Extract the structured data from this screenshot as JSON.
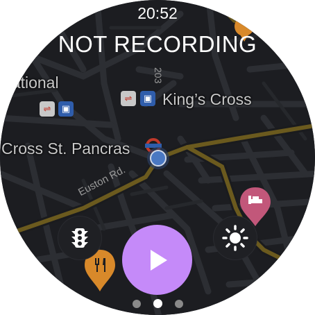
{
  "status_bar": {
    "time": "20:52"
  },
  "recording": {
    "status_text": "NOT RECORDING"
  },
  "map": {
    "labels": {
      "station_left": "national",
      "kings_cross": "King’s Cross",
      "st_pancras": "Cross St. Pancras",
      "euston_road": "Euston Rd.",
      "road_a203": "203"
    },
    "icons": [
      "rail-icon",
      "bus-icon",
      "underground-icon",
      "hotel-pin-icon",
      "restaurant-pin-icon",
      "current-location-icon"
    ]
  },
  "controls": {
    "traffic_button": "traffic-light-icon",
    "brightness_button": "brightness-icon",
    "play_button": "play-icon"
  },
  "pager": {
    "pages": 3,
    "current": 2
  },
  "colors": {
    "map_background": "#1c1d21",
    "major_road": "#6b5a1e",
    "play_accent": "#c58af9",
    "hotel_pin": "#c2577a",
    "restaurant_pin": "#d8892a",
    "location_dot": "#4a78c2"
  }
}
